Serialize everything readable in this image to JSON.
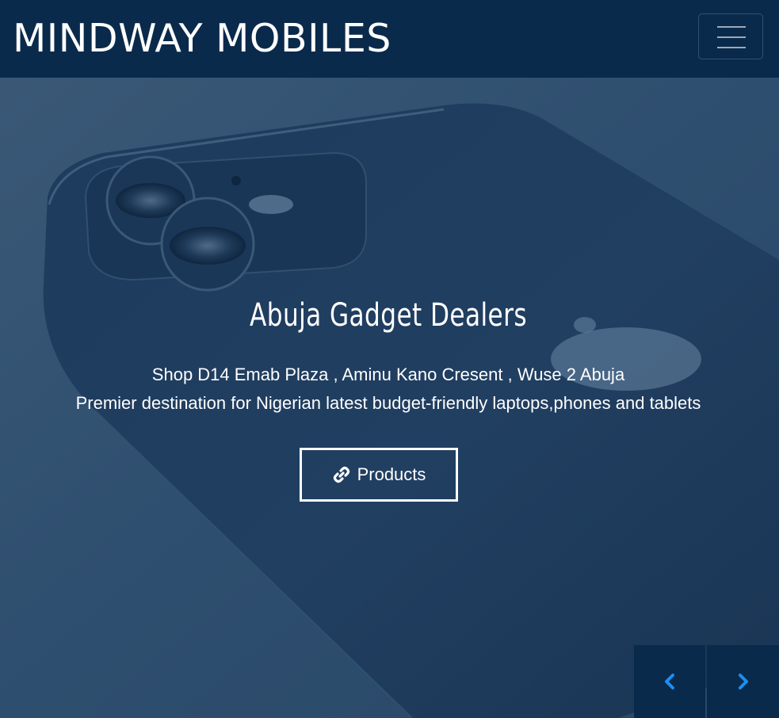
{
  "header": {
    "brand": "MINDWAY MOBILES",
    "menu_icon": "hamburger-menu-icon",
    "background_color": "#0a2a4c"
  },
  "hero": {
    "title": "Abuja Gadget Dealers",
    "address": "Shop D14 Emab Plaza , Aminu Kano Cresent , Wuse 2 Abuja",
    "tagline": "Premier destination for Nigerian latest budget-friendly laptops,phones and tablets",
    "button_label": "Products",
    "button_icon": "link-icon",
    "overlay_color": "#2b4a6b"
  },
  "carousel": {
    "prev_icon": "chevron-left-icon",
    "next_icon": "chevron-right-icon",
    "arrow_color": "#1e8ef0"
  }
}
